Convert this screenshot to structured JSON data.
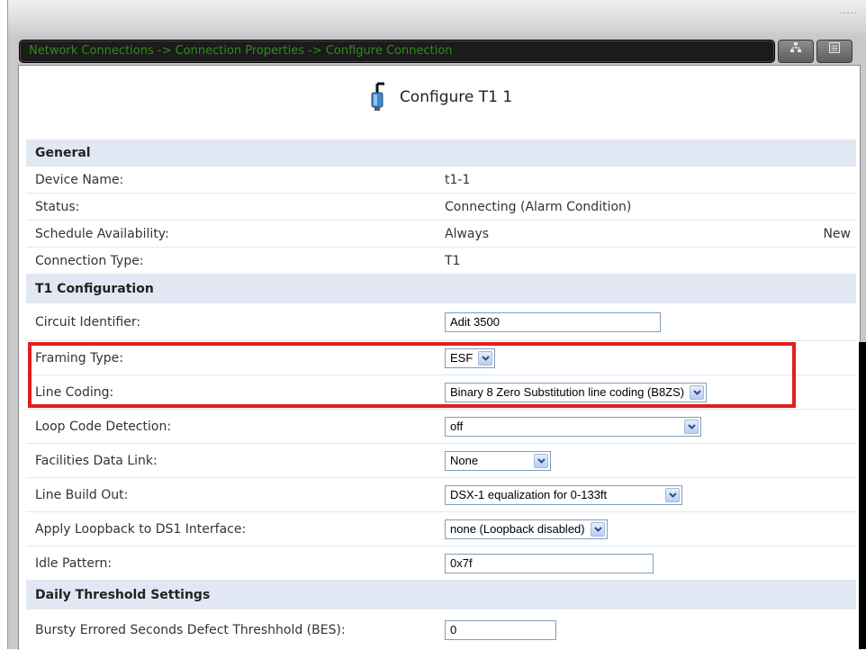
{
  "breadcrumb": "Network Connections -> Connection Properties -> Configure Connection",
  "page_title": "Configure T1 1",
  "sections": {
    "general": "General",
    "t1_config": "T1 Configuration",
    "daily": "Daily Threshold Settings"
  },
  "fields": {
    "device_name": {
      "label": "Device Name:",
      "value": "t1-1"
    },
    "status": {
      "label": "Status:",
      "value": "Connecting (Alarm Condition)"
    },
    "schedule": {
      "label": "Schedule Availability:",
      "value": "Always",
      "link": "New"
    },
    "connection_type": {
      "label": "Connection Type:",
      "value": "T1"
    },
    "circuit_id": {
      "label": "Circuit Identifier:",
      "value": "Adit 3500"
    },
    "framing": {
      "label": "Framing Type:",
      "value": "ESF"
    },
    "line_coding": {
      "label": "Line Coding:",
      "value": "Binary 8 Zero Substitution line coding (B8ZS)"
    },
    "loop_code": {
      "label": "Loop Code Detection:",
      "value": "off"
    },
    "fdl": {
      "label": "Facilities Data Link:",
      "value": "None"
    },
    "lbo": {
      "label": "Line Build Out:",
      "value": "DSX-1 equalization for 0-133ft"
    },
    "loopback": {
      "label": "Apply Loopback to DS1 Interface:",
      "value": "none (Loopback disabled)"
    },
    "idle": {
      "label": "Idle Pattern:",
      "value": "0x7f"
    },
    "bes": {
      "label": "Bursty Errored Seconds Defect Threshhold (BES):",
      "value": "0"
    }
  },
  "icons": {
    "title_icon": "t1-connector-icon",
    "toolbar_1": "sitemap-icon",
    "toolbar_2": "list-icon"
  },
  "colors": {
    "breadcrumb_text": "#2e8d1a",
    "header_bg": "#e1e8f3",
    "highlight": "#e21e1e"
  }
}
